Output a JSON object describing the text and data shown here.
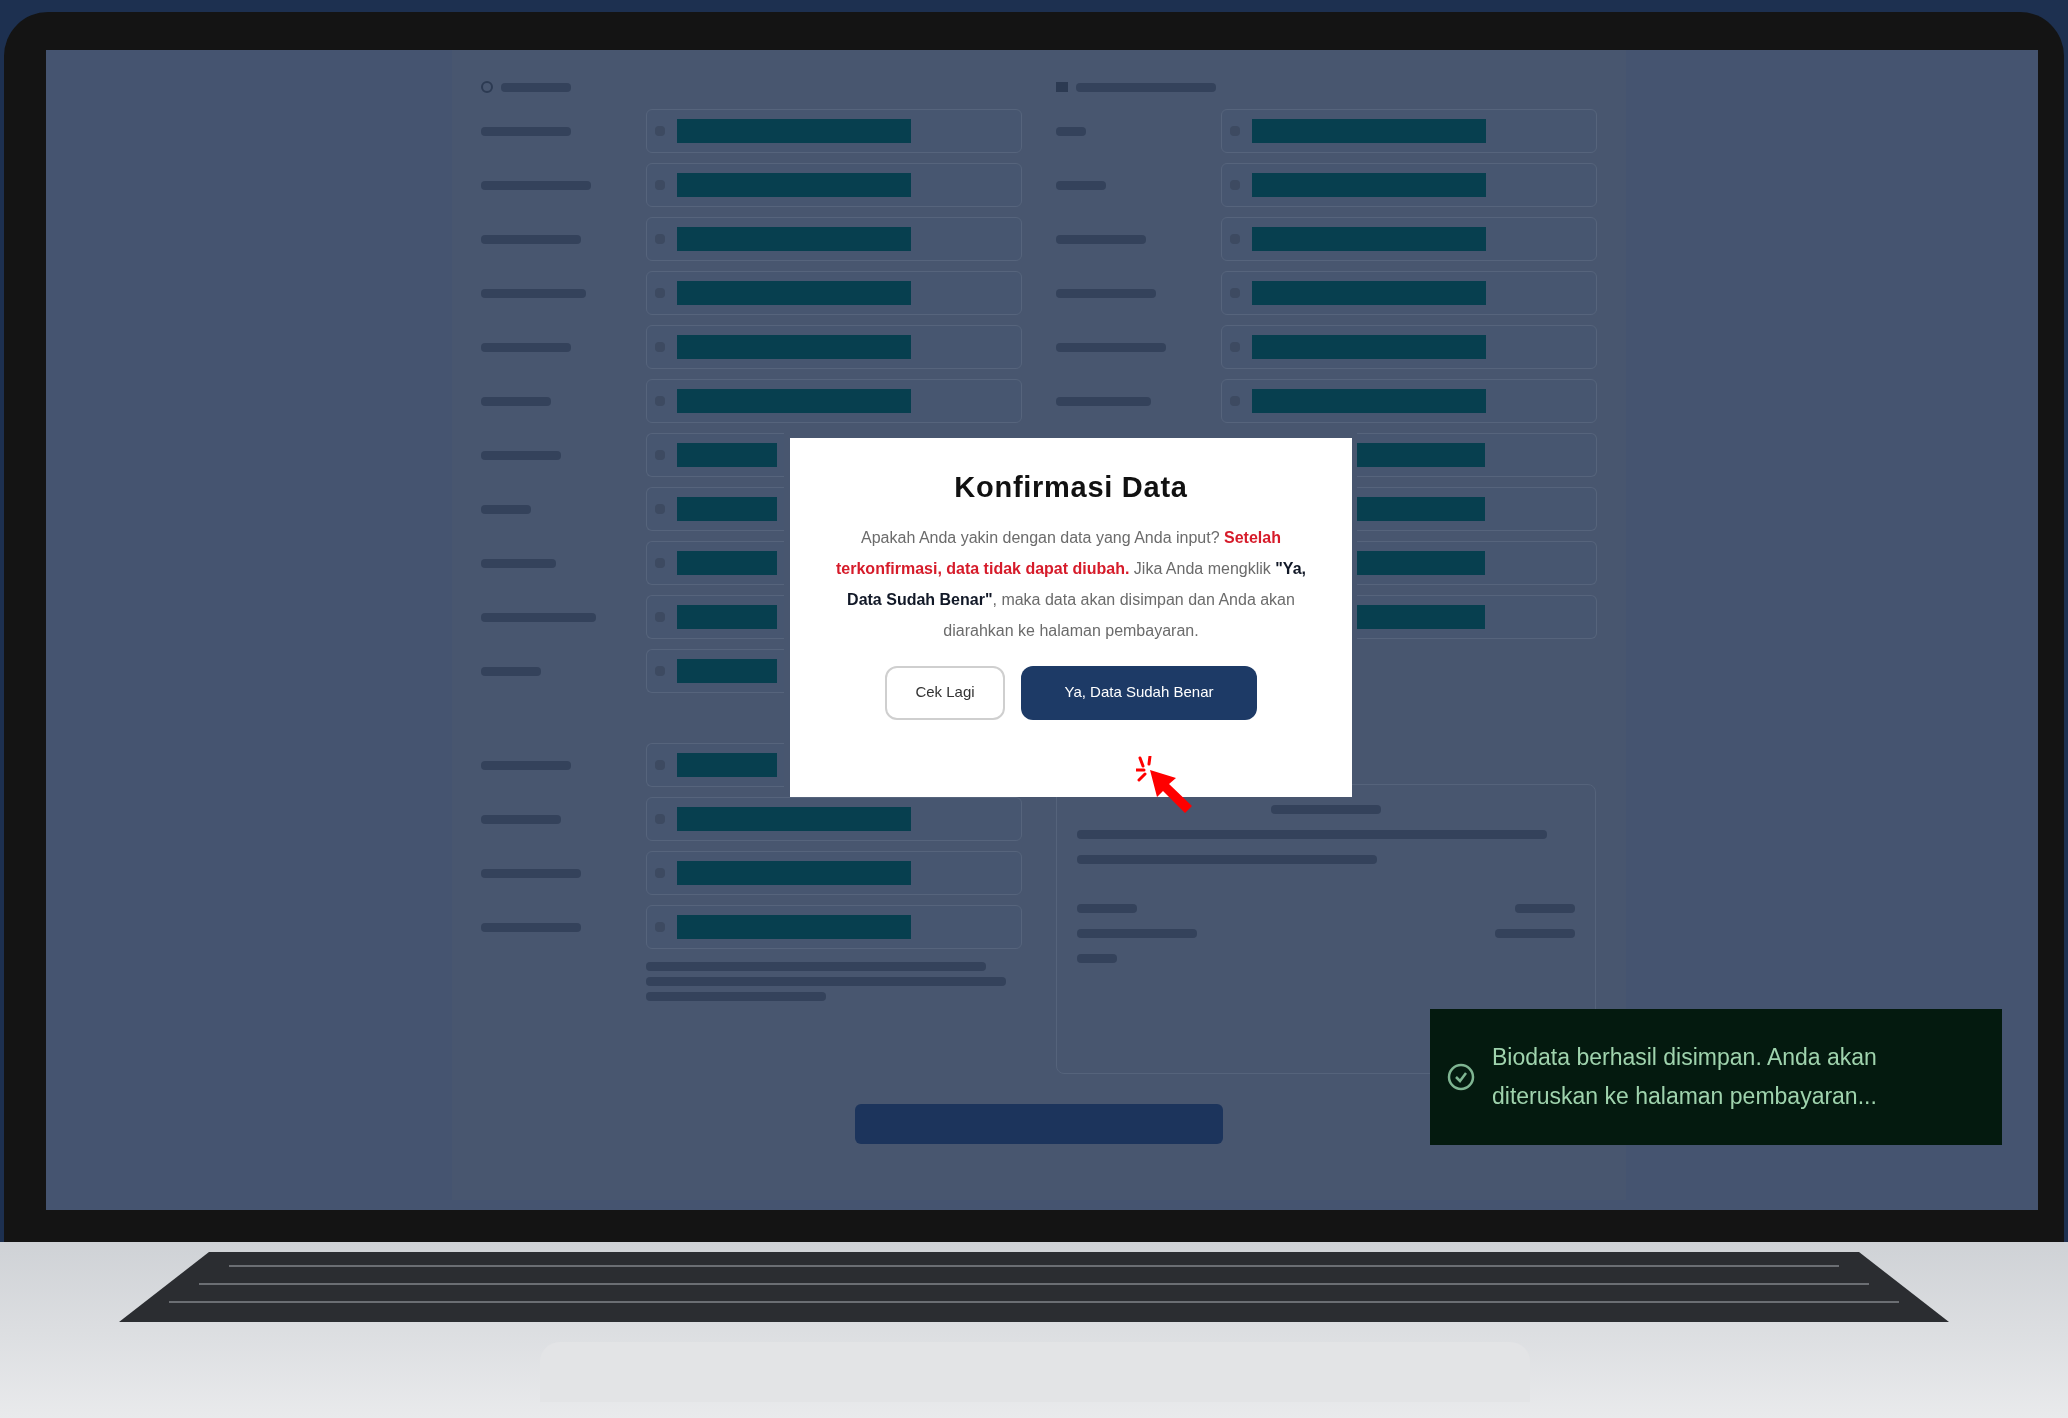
{
  "form": {
    "left_fields": [
      {
        "redacted": true
      },
      {
        "redacted": true
      },
      {
        "redacted": true
      },
      {
        "redacted": true
      },
      {
        "redacted": true
      },
      {
        "redacted": true
      },
      {
        "redacted": true
      },
      {
        "redacted": true
      },
      {
        "redacted": true
      },
      {
        "redacted": true
      },
      {
        "redacted": true
      },
      {
        "redacted": true
      },
      {
        "redacted": true
      },
      {
        "redacted": true
      },
      {
        "redacted": true
      }
    ],
    "right_fields": [
      {
        "redacted": true
      },
      {
        "redacted": true
      },
      {
        "redacted": true
      },
      {
        "redacted": true
      },
      {
        "redacted": true
      },
      {
        "redacted": true
      },
      {
        "redacted": true
      },
      {
        "redacted": true
      },
      {
        "redacted": true
      },
      {
        "redacted": true
      }
    ]
  },
  "dialog": {
    "title": "Konfirmasi Data",
    "message": [
      {
        "kind": "plain",
        "text": "Apakah Anda yakin dengan data yang Anda input? "
      },
      {
        "kind": "warning",
        "text": "Setelah terkonfirmasi, data tidak dapat diubah."
      },
      {
        "kind": "plain",
        "text": " Jika Anda mengklik "
      },
      {
        "kind": "emphasis",
        "text": "\"Ya, Data Sudah Benar\""
      },
      {
        "kind": "plain",
        "text": ", maka data akan disimpan dan Anda akan diarahkan ke halaman pembayaran."
      }
    ],
    "buttons": [
      {
        "label": "Cek Lagi",
        "kind": "secondary"
      },
      {
        "label": "Ya, Data Sudah Benar",
        "kind": "primary"
      }
    ]
  },
  "toast": {
    "message": "Biodata berhasil disimpan. Anda akan diteruskan ke halaman pembayaran..."
  }
}
